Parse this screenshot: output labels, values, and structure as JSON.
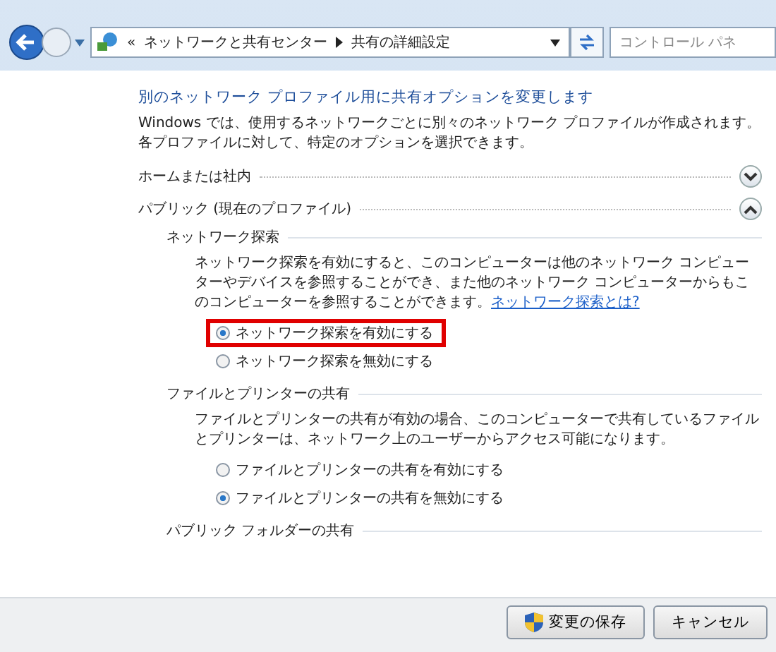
{
  "address_bar": {
    "breadcrumbs": [
      "«",
      "ネットワークと共有センター",
      "共有の詳細設定"
    ],
    "search_placeholder": "コントロール パネ"
  },
  "heading": "別のネットワーク プロファイル用に共有オプションを変更します",
  "intro": "Windows では、使用するネットワークごとに別々のネットワーク プロファイルが作成されます。各プロファイルに対して、特定のオプションを選択できます。",
  "profiles": [
    {
      "title": "ホームまたは社内",
      "expanded": false
    },
    {
      "title": "パブリック (現在のプロファイル)",
      "expanded": true
    }
  ],
  "sections": [
    {
      "title": "ネットワーク探索",
      "description": "ネットワーク探索を有効にすると、このコンピューターは他のネットワーク コンピューターやデバイスを参照することができ、また他のネットワーク コンピューターからもこのコンピューターを参照することができます。",
      "link": "ネットワーク探索とは?",
      "options": [
        {
          "label": "ネットワーク探索を有効にする",
          "selected": true,
          "highlighted": true
        },
        {
          "label": "ネットワーク探索を無効にする",
          "selected": false,
          "highlighted": false
        }
      ]
    },
    {
      "title": "ファイルとプリンターの共有",
      "description": "ファイルとプリンターの共有が有効の場合、このコンピューターで共有しているファイルとプリンターは、ネットワーク上のユーザーからアクセス可能になります。",
      "options": [
        {
          "label": "ファイルとプリンターの共有を有効にする",
          "selected": false,
          "highlighted": false
        },
        {
          "label": "ファイルとプリンターの共有を無効にする",
          "selected": true,
          "highlighted": false
        }
      ]
    },
    {
      "title": "パブリック フォルダーの共有"
    }
  ],
  "buttons": [
    {
      "label": "変更の保存",
      "kind": "shield"
    },
    {
      "label": "キャンセル",
      "kind": "plain"
    }
  ]
}
